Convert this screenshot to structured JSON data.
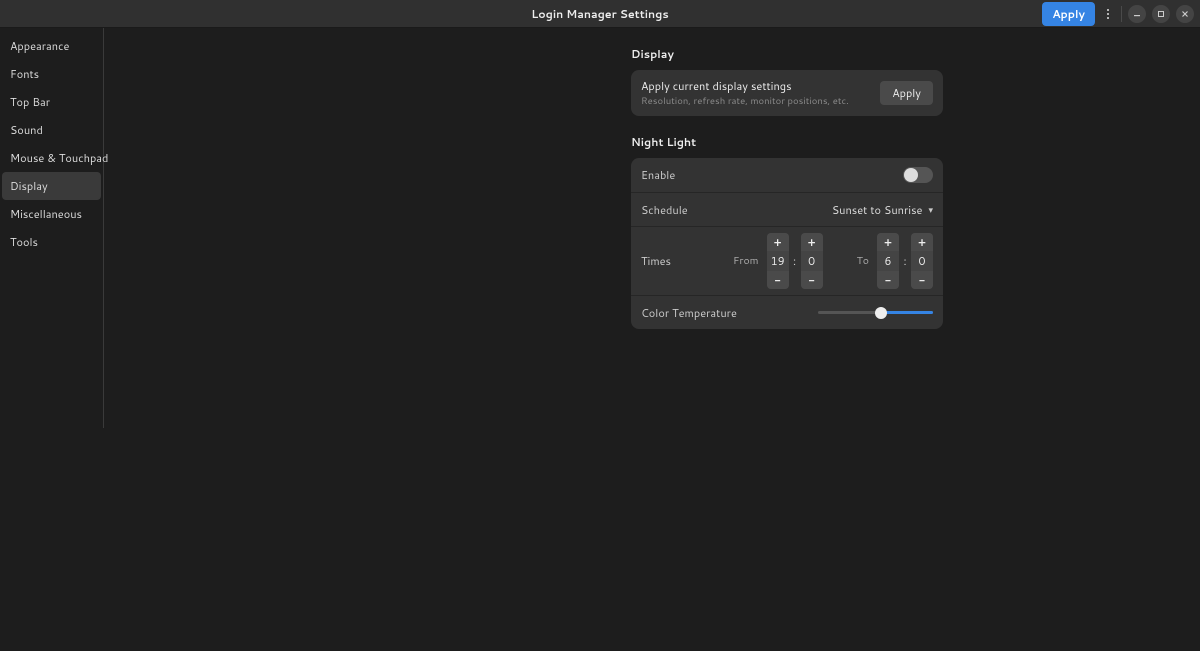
{
  "header": {
    "title": "Login Manager Settings",
    "apply_label": "Apply"
  },
  "sidebar": {
    "items": [
      {
        "label": "Appearance"
      },
      {
        "label": "Fonts"
      },
      {
        "label": "Top Bar"
      },
      {
        "label": "Sound"
      },
      {
        "label": "Mouse & Touchpad"
      },
      {
        "label": "Display"
      },
      {
        "label": "Miscellaneous"
      },
      {
        "label": "Tools"
      }
    ],
    "active_index": 5
  },
  "display": {
    "section_title": "Display",
    "apply_row": {
      "title": "Apply current display settings",
      "subtitle": "Resolution, refresh rate, monitor positions, etc.",
      "button": "Apply"
    }
  },
  "night_light": {
    "section_title": "Night Light",
    "enable": {
      "label": "Enable",
      "value": false
    },
    "schedule": {
      "label": "Schedule",
      "value": "Sunset to Sunrise"
    },
    "times": {
      "label": "Times",
      "from_label": "From",
      "to_label": "To",
      "from_h": "19",
      "from_m": "0",
      "to_h": "6",
      "to_m": "0"
    },
    "color_temp": {
      "label": "Color Temperature",
      "percent": 55
    }
  }
}
